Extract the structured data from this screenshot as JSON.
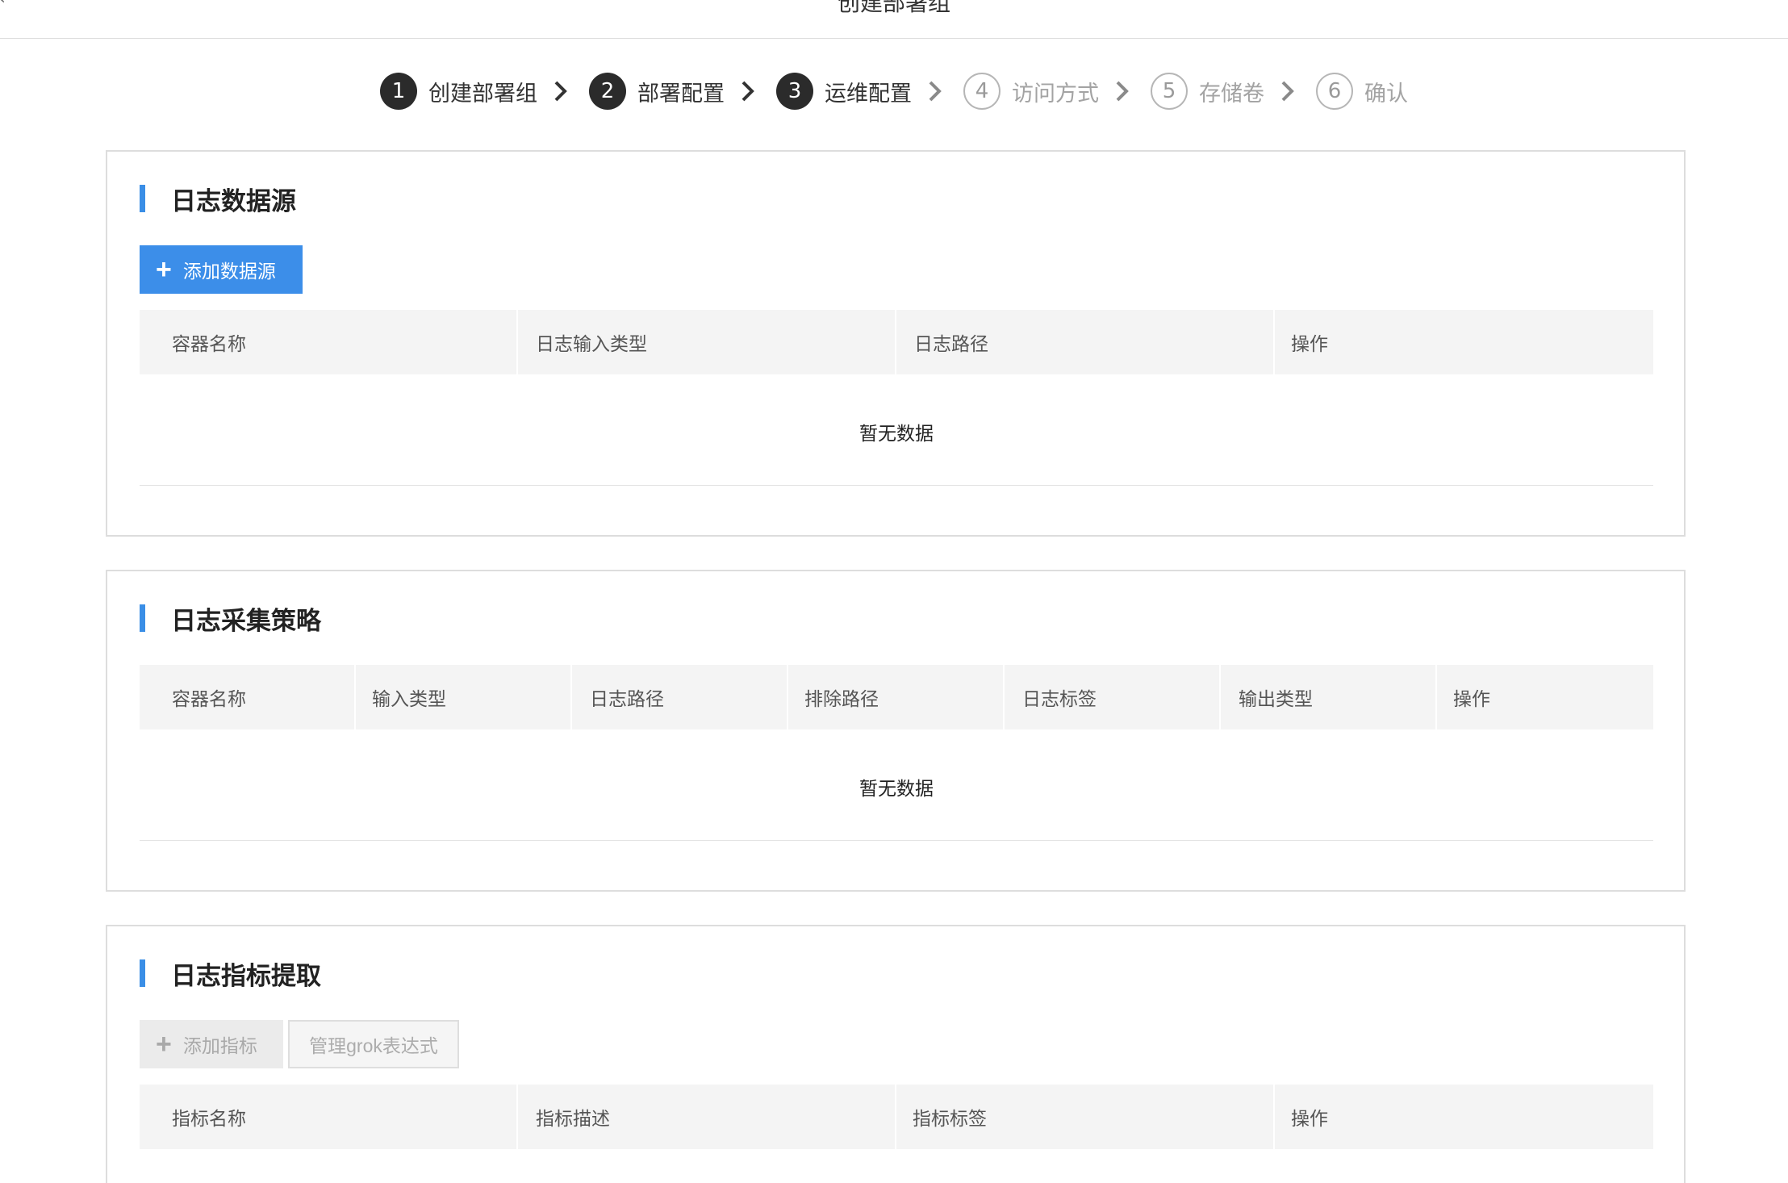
{
  "header": {
    "title": "创建部署组",
    "back_icon": "chevron-left-icon"
  },
  "stepper": {
    "steps": [
      {
        "num": "1",
        "label": "创建部署组",
        "state": "done"
      },
      {
        "num": "2",
        "label": "部署配置",
        "state": "done"
      },
      {
        "num": "3",
        "label": "运维配置",
        "state": "done"
      },
      {
        "num": "4",
        "label": "访问方式",
        "state": "todo"
      },
      {
        "num": "5",
        "label": "存储卷",
        "state": "todo"
      },
      {
        "num": "6",
        "label": "确认",
        "state": "todo"
      }
    ]
  },
  "datasource": {
    "title": "日志数据源",
    "add_button": "添加数据源",
    "columns": [
      "容器名称",
      "日志输入类型",
      "日志路径",
      "操作"
    ],
    "empty": "暂无数据"
  },
  "strategy": {
    "title": "日志采集策略",
    "columns": [
      "容器名称",
      "输入类型",
      "日志路径",
      "排除路径",
      "日志标签",
      "输出类型",
      "操作"
    ],
    "empty": "暂无数据"
  },
  "metrics": {
    "title": "日志指标提取",
    "add_button": "添加指标",
    "grok_button": "管理grok表达式",
    "columns": [
      "指标名称",
      "指标描述",
      "指标标签",
      "操作"
    ]
  },
  "colors": {
    "accent": "#3c8ee9",
    "step_done": "#2b2b2b",
    "step_todo": "#b6b6b6"
  }
}
